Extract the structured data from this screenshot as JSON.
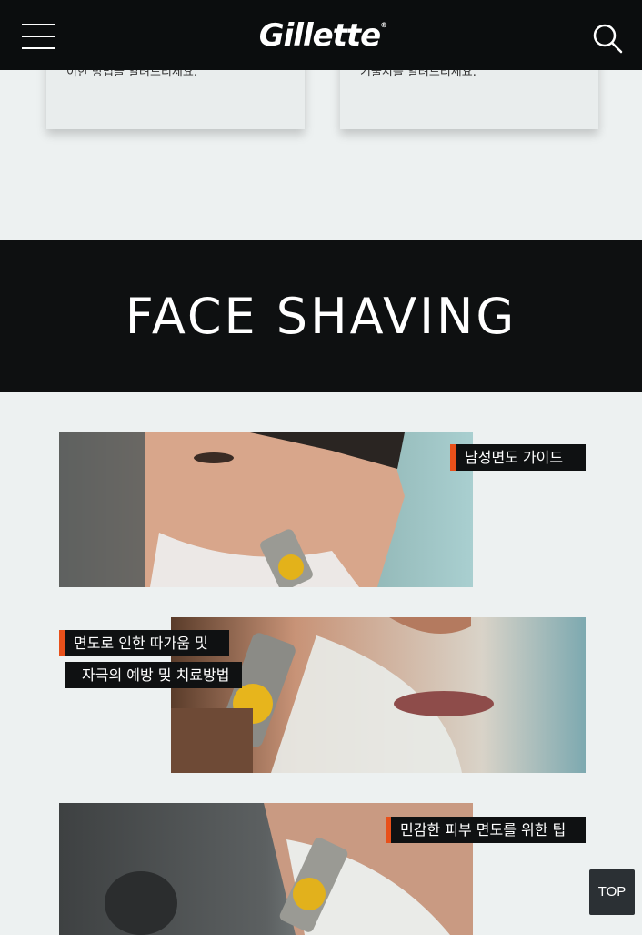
{
  "header": {
    "logo_text": "Gillette",
    "logo_mark": "®",
    "menu_icon": "hamburger-menu-icon",
    "search_icon": "search-icon"
  },
  "cards": [
    {
      "snippet": "이한 방법을 알려드리세요."
    },
    {
      "snippet": "기울지를 알려드리세요."
    }
  ],
  "section": {
    "title": "FACE SHAVING"
  },
  "articles": [
    {
      "tag_lines": [
        "남성면도 가이드"
      ]
    },
    {
      "tag_lines": [
        "면도로 인한 따가움 및",
        "자극의 예방 및 치료방법"
      ]
    },
    {
      "tag_lines": [
        "민감한 피부 면도를 위한 팁"
      ]
    }
  ],
  "top_button": {
    "label": "TOP"
  },
  "colors": {
    "header_bg": "#0b0d0e",
    "page_bg": "#edf1f1",
    "banner_bg": "#0e1011",
    "accent": "#e8501a",
    "tag_bg": "#0f1112"
  }
}
